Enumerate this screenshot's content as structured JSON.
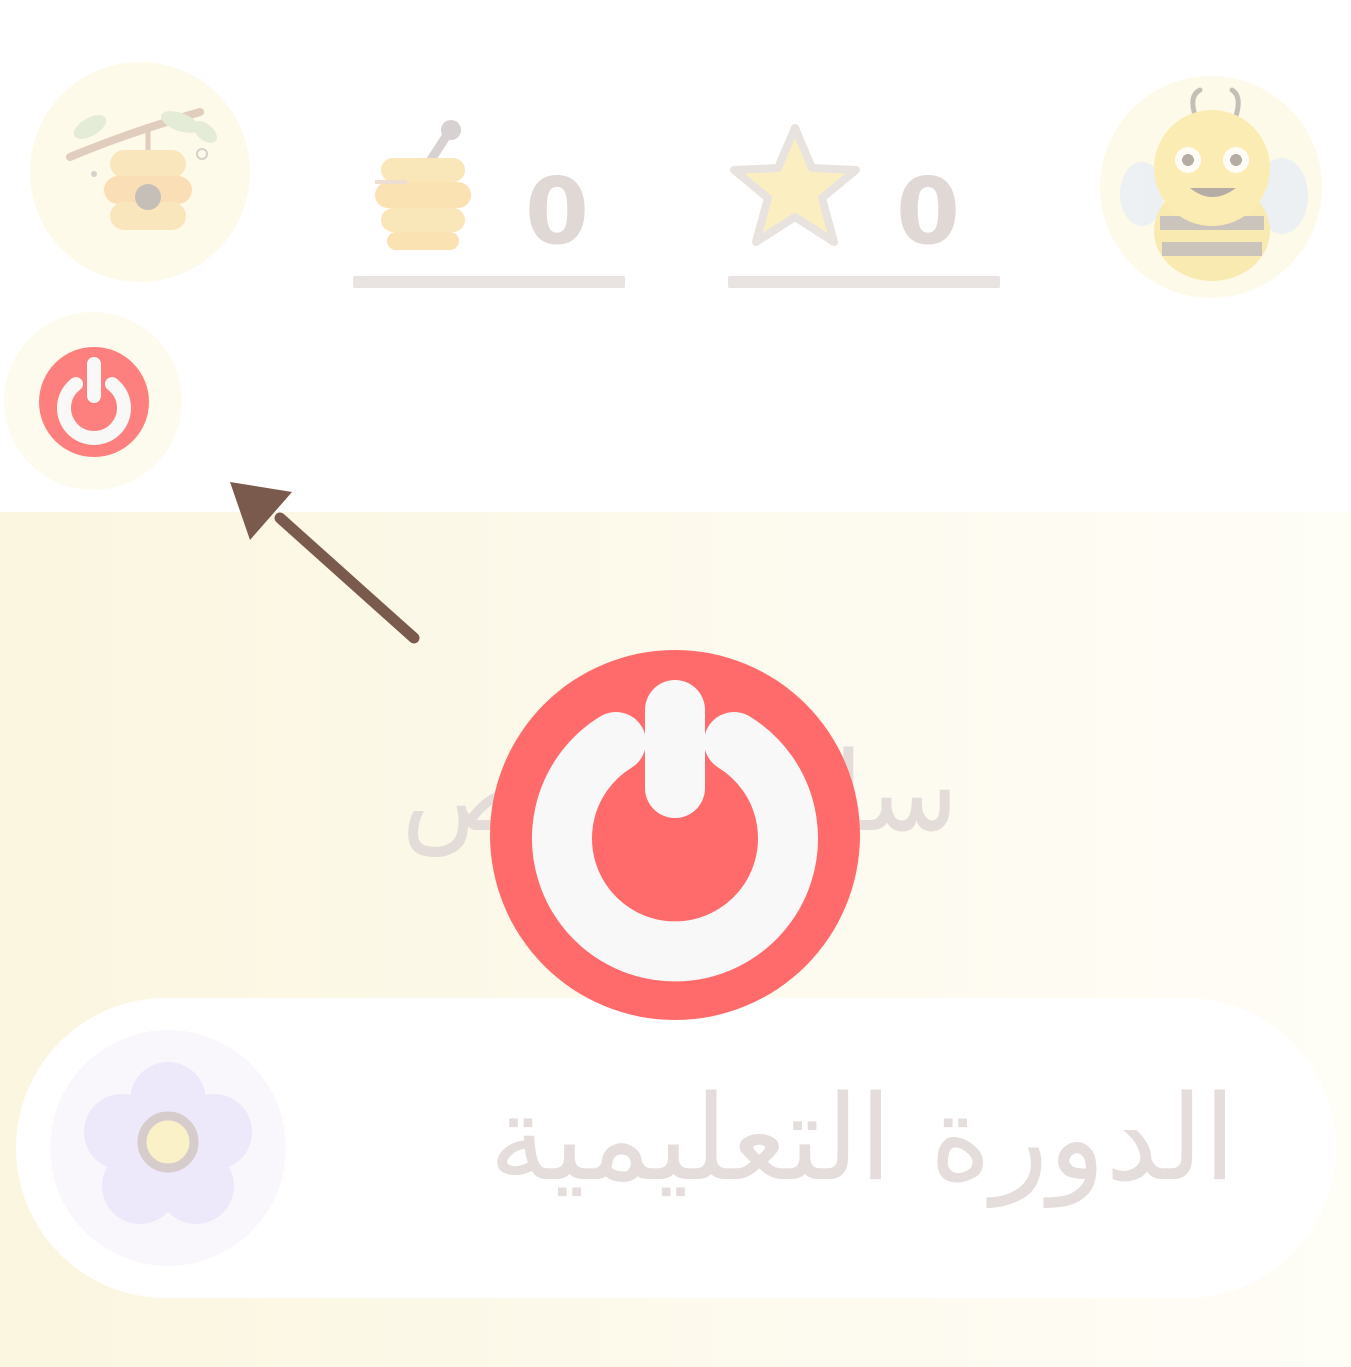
{
  "header": {
    "honey_count": "0",
    "star_count": "0"
  },
  "main": {
    "section_title": "ساحة الخص",
    "course_card": {
      "title": "الدورة التعليمية"
    }
  },
  "icons": {
    "hive": "beehive-branch-icon",
    "honey": "honey-jar-icon",
    "star": "star-icon",
    "avatar": "bee-avatar-icon",
    "logout": "power-icon",
    "flower": "flower-icon",
    "arrow": "pointer-arrow-icon"
  },
  "colors": {
    "accent_red": "#ff6b6b",
    "panel_bg": "#fbf6df",
    "arrow": "#7a5a4c",
    "icon_white": "#f8f8f9"
  }
}
